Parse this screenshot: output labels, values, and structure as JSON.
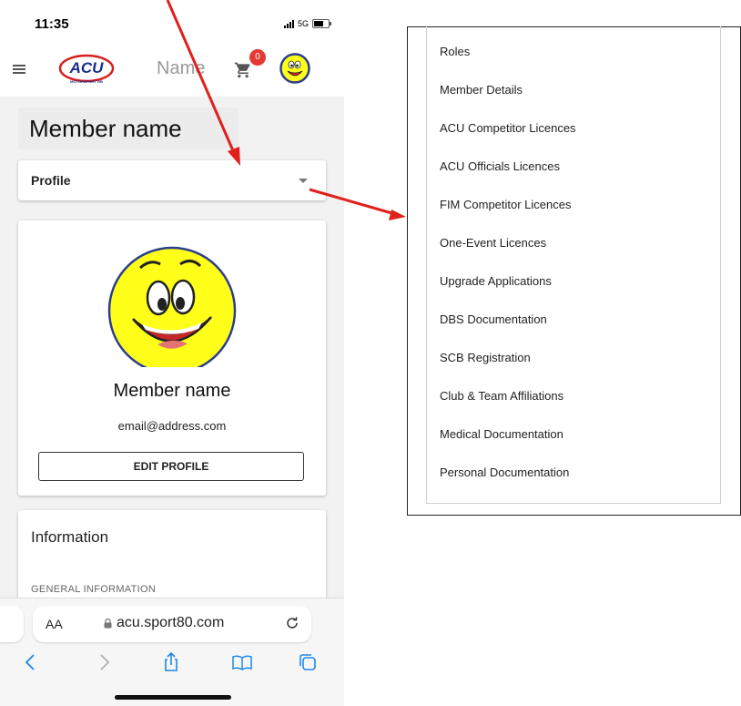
{
  "status": {
    "time": "11:35",
    "network": "5G"
  },
  "appbar": {
    "title": "Name",
    "cart_count": "0",
    "logo_text": "ACU",
    "logo_subtext": "MOTORSPORT GB"
  },
  "page": {
    "member_title": "Member name"
  },
  "select": {
    "selected": "Profile"
  },
  "profile_card": {
    "name": "Member name",
    "email": "email@address.com",
    "edit_label": "EDIT PROFILE"
  },
  "info_card": {
    "title": "Information",
    "subtitle": "GENERAL INFORMATION"
  },
  "browser": {
    "aa": "AA",
    "url": "acu.sport80.com"
  },
  "dropdown_options": [
    "Roles",
    "Member Details",
    "ACU Competitor Licences",
    "ACU Officials Licences",
    "FIM Competitor Licences",
    "One-Event Licences",
    "Upgrade Applications",
    "DBS Documentation",
    "SCB Registration",
    "Club & Team Affiliations",
    "Medical Documentation",
    "Personal Documentation"
  ],
  "colors": {
    "accent_red": "#e53935",
    "annotation_arrow": "#e0201c",
    "brand_blue": "#1a2f8c",
    "smiley_yellow": "#ffff1a"
  },
  "icons": [
    "menu-icon",
    "cart-icon",
    "lock-icon",
    "reload-icon",
    "back-icon",
    "forward-icon",
    "share-icon",
    "bookmarks-icon",
    "tabs-icon"
  ]
}
